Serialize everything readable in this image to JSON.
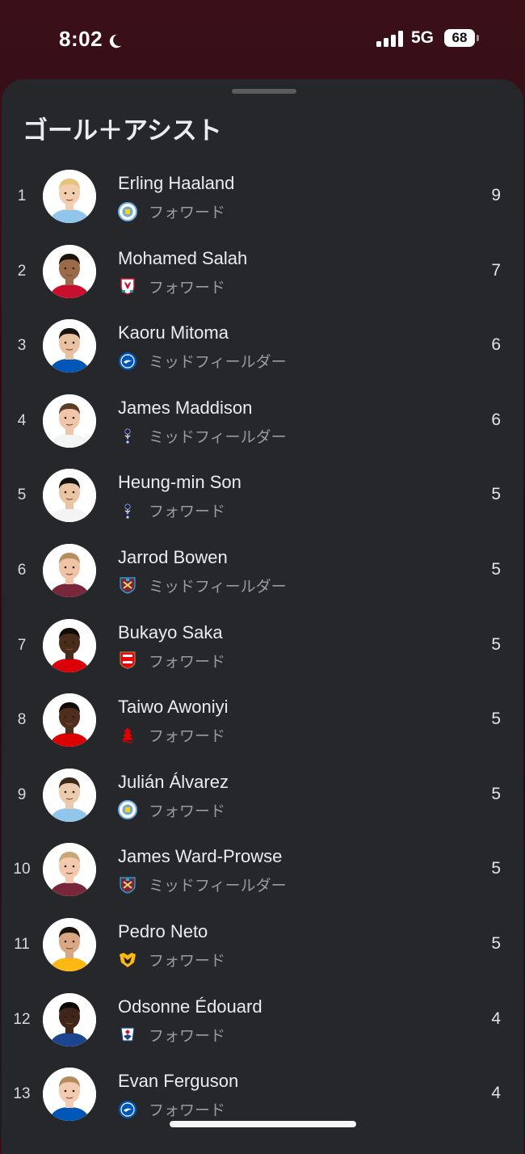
{
  "status_bar": {
    "time": "8:02",
    "network": "5G",
    "battery": "68"
  },
  "sheet": {
    "title": "ゴール＋アシスト"
  },
  "players": [
    {
      "rank": "1",
      "name": "Erling Haaland",
      "position": "フォワード",
      "club_icon": "man-city-crest",
      "value": "9",
      "skin": "#f3cdb0",
      "hair": "#e8c27a",
      "kit": "#8fc6ea"
    },
    {
      "rank": "2",
      "name": "Mohamed Salah",
      "position": "フォワード",
      "club_icon": "liverpool-crest",
      "value": "7",
      "skin": "#9b6a48",
      "hair": "#1e140e",
      "kit": "#c8102e"
    },
    {
      "rank": "3",
      "name": "Kaoru Mitoma",
      "position": "ミッドフィールダー",
      "club_icon": "brighton-crest",
      "value": "6",
      "skin": "#e8c1a0",
      "hair": "#181412",
      "kit": "#0057b8"
    },
    {
      "rank": "4",
      "name": "James Maddison",
      "position": "ミッドフィールダー",
      "club_icon": "tottenham-crest",
      "value": "6",
      "skin": "#f0c6aa",
      "hair": "#5a3c28",
      "kit": "#f4f4f4"
    },
    {
      "rank": "5",
      "name": "Heung-min Son",
      "position": "フォワード",
      "club_icon": "tottenham-crest",
      "value": "5",
      "skin": "#ebc4a4",
      "hair": "#15110f",
      "kit": "#f4f4f4"
    },
    {
      "rank": "6",
      "name": "Jarrod Bowen",
      "position": "ミッドフィールダー",
      "club_icon": "west-ham-crest",
      "value": "5",
      "skin": "#f0c3a6",
      "hair": "#b68d5f",
      "kit": "#7a263a"
    },
    {
      "rank": "7",
      "name": "Bukayo Saka",
      "position": "フォワード",
      "club_icon": "arsenal-crest",
      "value": "5",
      "skin": "#4a2c1c",
      "hair": "#120c08",
      "kit": "#db0007"
    },
    {
      "rank": "8",
      "name": "Taiwo Awoniyi",
      "position": "フォワード",
      "club_icon": "nottingham-forest-crest",
      "value": "5",
      "skin": "#4f2e1e",
      "hair": "#100b08",
      "kit": "#dd0000"
    },
    {
      "rank": "9",
      "name": "Julián Álvarez",
      "position": "フォワード",
      "club_icon": "man-city-crest",
      "value": "5",
      "skin": "#eccaae",
      "hair": "#3b281b",
      "kit": "#8fc6ea"
    },
    {
      "rank": "10",
      "name": "James Ward-Prowse",
      "position": "ミッドフィールダー",
      "club_icon": "west-ham-crest",
      "value": "5",
      "skin": "#f2c9ad",
      "hair": "#c9a676",
      "kit": "#7a263a"
    },
    {
      "rank": "11",
      "name": "Pedro Neto",
      "position": "フォワード",
      "club_icon": "wolves-crest",
      "value": "5",
      "skin": "#d9a783",
      "hair": "#1c130e",
      "kit": "#fdb913"
    },
    {
      "rank": "12",
      "name": "Odsonne Édouard",
      "position": "フォワード",
      "club_icon": "crystal-palace-crest",
      "value": "4",
      "skin": "#3f2619",
      "hair": "#0d0906",
      "kit": "#1b458f"
    },
    {
      "rank": "13",
      "name": "Evan Ferguson",
      "position": "フォワード",
      "club_icon": "brighton-crest",
      "value": "4",
      "skin": "#f2cbb0",
      "hair": "#b58c60",
      "kit": "#0057b8"
    }
  ],
  "crest_colors": {
    "man-city-crest": "#6cabdd",
    "liverpool-crest": "#c8102e",
    "brighton-crest": "#0057b8",
    "tottenham-crest": "#132257",
    "west-ham-crest": "#7a263a",
    "arsenal-crest": "#ef0107",
    "nottingham-forest-crest": "#dd0000",
    "wolves-crest": "#fdb913",
    "crystal-palace-crest": "#1b458f"
  }
}
